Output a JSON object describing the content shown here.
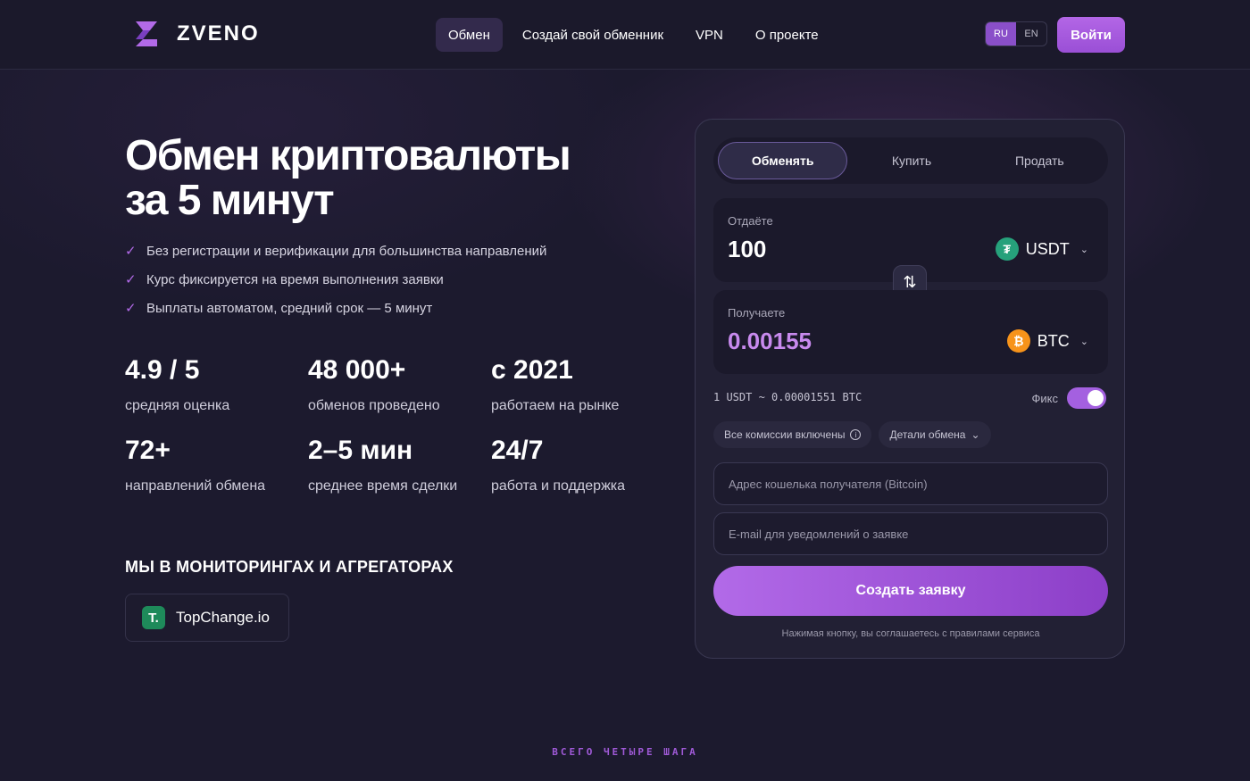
{
  "header": {
    "logo_text": "ZVENO",
    "nav": [
      "Обмен",
      "Создай свой обменник",
      "VPN",
      "О проекте"
    ],
    "languages": [
      "RU",
      "EN"
    ],
    "login_label": "Войти"
  },
  "hero": {
    "title_line1": "Обмен криптовалюты",
    "title_line2": "за 5 минут",
    "features": [
      "Без регистрации и верификации для большинства направлений",
      "Курс фиксируется на время выполнения заявки",
      "Выплаты автоматом, средний срок — 5 минут"
    ],
    "stats": [
      {
        "value": "4.9 / 5",
        "label": "средняя оценка"
      },
      {
        "value": "48 000+",
        "label": "обменов проведено"
      },
      {
        "value": "с 2021",
        "label": "работаем на рынке"
      },
      {
        "value": "72+",
        "label": "направлений обмена"
      },
      {
        "value": "2–5 мин",
        "label": "среднее время сделки"
      },
      {
        "value": "24/7",
        "label": "работа и поддержка"
      }
    ],
    "monitor_title": "МЫ В МОНИТОРИНГАХ И АГРЕГАТОРАХ",
    "monitor_name": "TopChange.io",
    "monitor_logo": "T."
  },
  "steps_label": "ВСЕГО ЧЕТЫРЕ ШАГА",
  "exchange": {
    "tabs": [
      "Обменять",
      "Купить",
      "Продать"
    ],
    "give_label": "Отдаёте",
    "give_amount": "100",
    "give_coin": "USDT",
    "give_coin_symbol": "₮",
    "receive_label": "Получаете",
    "receive_amount": "0.00155",
    "receive_coin": "BTC",
    "receive_coin_symbol": "₿",
    "rate": "1 USDT ~ 0.00001551 BTC",
    "fix_label": "Фикс",
    "chip_fees": "Все комиссии включены",
    "chip_details": "Детали обмена",
    "wallet_placeholder": "Адрес кошелька получателя (Bitcoin)",
    "email_placeholder": "E-mail для уведомлений о заявке",
    "submit_label": "Создать заявку",
    "terms": "Нажимая кнопку, вы соглашаетесь с правилами сервиса"
  },
  "colors": {
    "accent": "#a460e0",
    "background": "#1c1a2e",
    "usdt": "#26a17b",
    "btc": "#f7931a"
  }
}
